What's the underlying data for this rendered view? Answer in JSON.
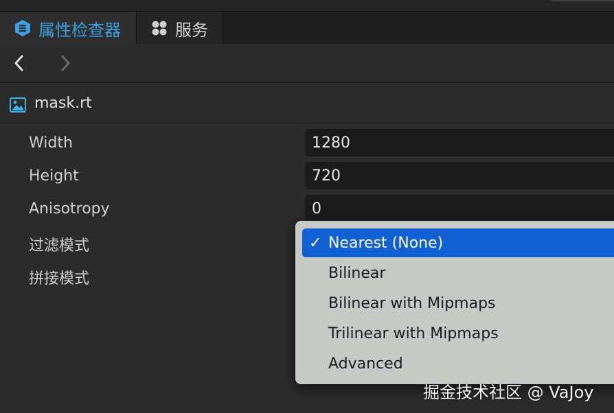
{
  "tabs": [
    {
      "label": "属性检查器",
      "icon": "inspector-hex-icon",
      "active": true
    },
    {
      "label": "服务",
      "icon": "services-grid-icon",
      "active": false
    }
  ],
  "nav": {
    "back_icon": "chevron-left-icon",
    "forward_icon": "chevron-right-icon"
  },
  "asset": {
    "name": "mask.rt",
    "icon": "image-icon"
  },
  "properties": [
    {
      "label": "Width",
      "value": "1280"
    },
    {
      "label": "Height",
      "value": "720"
    },
    {
      "label": "Anisotropy",
      "value": "0"
    },
    {
      "label": "过滤模式"
    },
    {
      "label": "拼接模式"
    }
  ],
  "dropdown": {
    "items": [
      {
        "label": "Nearest (None)",
        "selected": true,
        "check": "✓"
      },
      {
        "label": "Bilinear"
      },
      {
        "label": "Bilinear with Mipmaps"
      },
      {
        "label": "Trilinear with Mipmaps"
      },
      {
        "label": "Advanced"
      }
    ]
  },
  "watermark": "掘金技术社区 @ VaJoy",
  "colors": {
    "accent": "#3e9fe0",
    "selection": "#1261d4",
    "background": "#2b2b2b",
    "menu": "#c6cac7"
  }
}
